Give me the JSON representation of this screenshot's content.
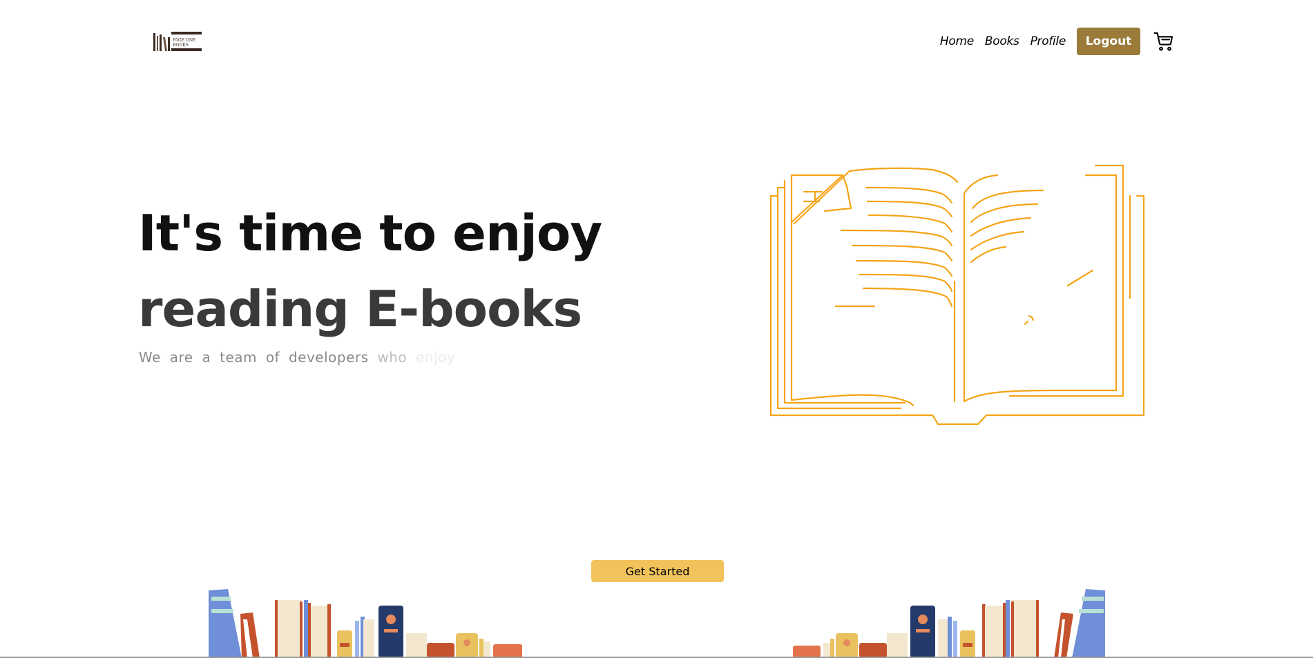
{
  "nav": {
    "links": [
      "Home",
      "Books",
      "Profile"
    ],
    "logout_label": "Logout"
  },
  "hero": {
    "line1": "It's time to enjoy",
    "line2": "reading E-books",
    "sub_visible": "We are a team of developers ",
    "sub_fade1": "who ",
    "sub_fade2": "enjoy"
  },
  "cta": {
    "label": "Get Started"
  },
  "icons": {
    "cart": "cart-icon",
    "logo": "bookshelf-logo",
    "illustration": "open-book-illustration"
  },
  "colors": {
    "accent": "#9a7b3a",
    "cta": "#f2c35b",
    "illustration_stroke": "#f5a315"
  }
}
